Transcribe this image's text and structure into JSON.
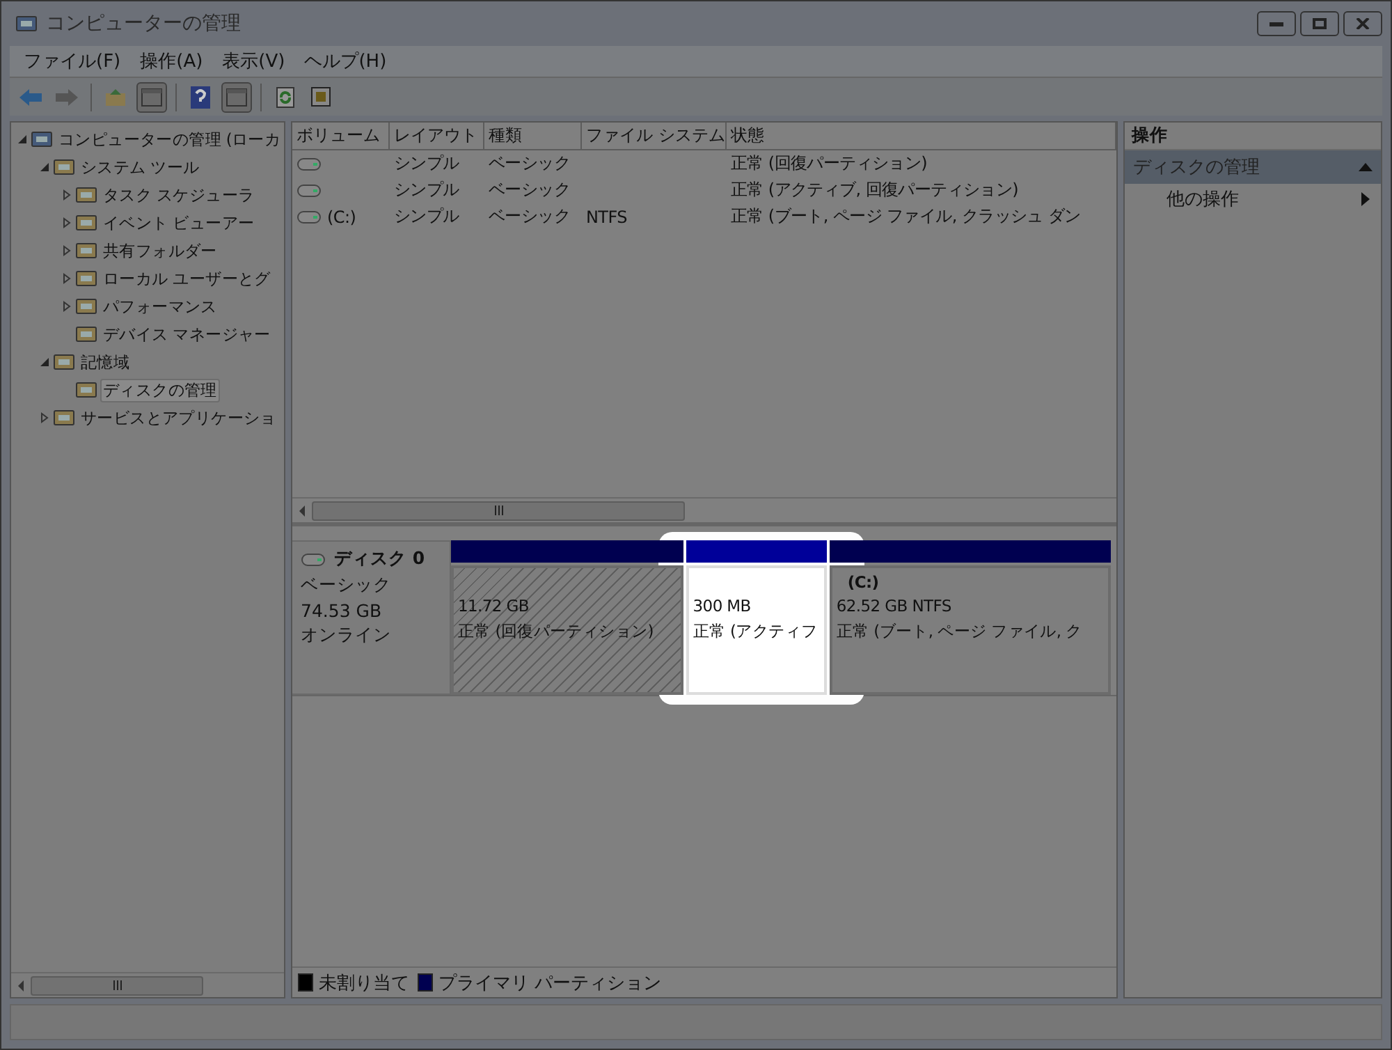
{
  "window": {
    "title": "コンピューターの管理"
  },
  "menu": [
    "ファイル(F)",
    "操作(A)",
    "表示(V)",
    "ヘルプ(H)"
  ],
  "tree": [
    {
      "label": "コンピューターの管理 (ローカ",
      "expanded": true,
      "selected": false,
      "children": [
        {
          "label": "システム ツール",
          "expanded": true,
          "selected": false,
          "children": [
            {
              "label": "タスク スケジューラ",
              "expanded": false,
              "selected": false
            },
            {
              "label": "イベント ビューアー",
              "expanded": false,
              "selected": false
            },
            {
              "label": "共有フォルダー",
              "expanded": false,
              "selected": false
            },
            {
              "label": "ローカル ユーザーとグ",
              "expanded": false,
              "selected": false
            },
            {
              "label": "パフォーマンス",
              "expanded": false,
              "selected": false
            },
            {
              "label": "デバイス マネージャー",
              "selected": false
            }
          ]
        },
        {
          "label": "記憶域",
          "expanded": true,
          "selected": false,
          "children": [
            {
              "label": "ディスクの管理",
              "selected": true
            }
          ]
        },
        {
          "label": "サービスとアプリケーショ",
          "expanded": false,
          "selected": false
        }
      ]
    }
  ],
  "volumes": {
    "columns": [
      "ボリューム",
      "レイアウト",
      "種類",
      "ファイル システム",
      "状態"
    ],
    "rows": [
      {
        "layout": "シンプル",
        "type": "ベーシック",
        "status": "正常 (回復パーティション)"
      },
      {
        "layout": "シンプル",
        "type": "ベーシック",
        "status": "正常 (アクティブ, 回復パーティション)"
      },
      {
        "volume": "(C:)",
        "layout": "シンプル",
        "type": "ベーシック",
        "filesystem": "NTFS",
        "status": "正常 (ブート, ページ ファイル, クラッシュ ダン"
      }
    ]
  },
  "disk": {
    "name": "ディスク 0",
    "type": "ベーシック",
    "size": "74.53 GB",
    "state": "オンライン",
    "partitions": [
      {
        "kind": "hatched",
        "size": "11.72 GB",
        "status": "正常 (回復パーティション)"
      },
      {
        "kind": "highlighted",
        "size": "300 MB",
        "status": "正常 (アクティフ"
      },
      {
        "kind": "plain",
        "label": "(C:)",
        "size": "62.52 GB NTFS",
        "status": "正常 (ブート, ページ ファイル, ク"
      }
    ]
  },
  "legend": [
    {
      "label": "未割り当て",
      "color": "#000000"
    },
    {
      "label": "プライマリ パーティション",
      "color": "#000050"
    }
  ],
  "actions": {
    "header": "操作",
    "section": {
      "title": "ディスクの管理",
      "expanded": true
    },
    "items": [
      "他の操作"
    ]
  }
}
